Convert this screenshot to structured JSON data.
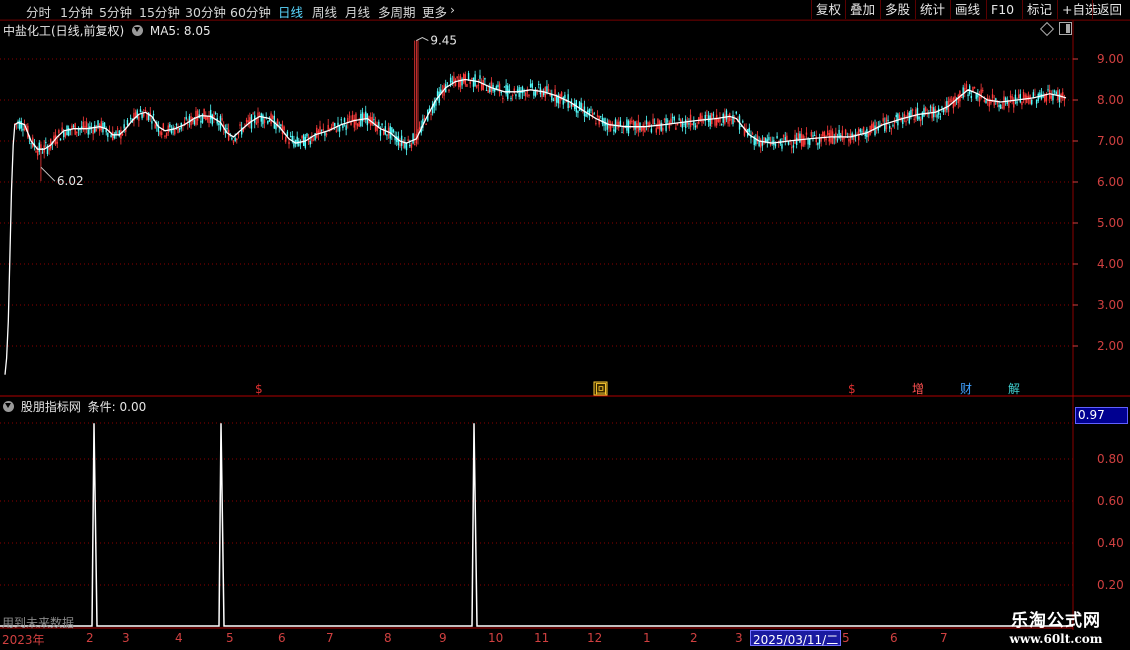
{
  "toolbar": {
    "left_items": [
      "分时",
      "1分钟",
      "5分钟",
      "15分钟",
      "30分钟",
      "60分钟",
      "日线",
      "周线",
      "月线",
      "多周期",
      "更多"
    ],
    "active_item": "日线",
    "more_arrow": "›",
    "right_items": [
      "复权",
      "叠加",
      "多股",
      "统计",
      "画线",
      "F10",
      "标记",
      "+自选",
      "返回"
    ]
  },
  "main_panel": {
    "title": "中盐化工(日线,前复权)",
    "ma_label": "MA5: 8.05",
    "high_label": "9.45",
    "low_label": "6.02",
    "y_ticks": [
      "9.00",
      "8.00",
      "7.00",
      "6.00",
      "5.00",
      "4.00",
      "3.00",
      "2.00"
    ],
    "event_markers": [
      {
        "text": "$",
        "color": "#e03030"
      },
      {
        "text": "回",
        "color": "#ffcc33"
      },
      {
        "text": "$",
        "color": "#e03030"
      },
      {
        "text": "增",
        "color": "#ff5050"
      },
      {
        "text": "财",
        "color": "#40a0ff"
      },
      {
        "text": "解",
        "color": "#40d0d0"
      }
    ]
  },
  "indicator_panel": {
    "title": "股朋指标网",
    "condition_label": "条件: 0.00",
    "current_value": "0.97",
    "y_ticks": [
      "0.80",
      "0.60",
      "0.40",
      "0.20"
    ],
    "future_data_note": "用到未来数据"
  },
  "x_axis": {
    "labels": [
      "2023年",
      "2",
      "3",
      "4",
      "5",
      "6",
      "7",
      "8",
      "9",
      "10",
      "11",
      "12",
      "1",
      "2",
      "3",
      "5",
      "6",
      "7"
    ],
    "cursor_date": "2025/03/11/二"
  },
  "watermark": {
    "title": "乐淘公式网",
    "url": "www.60lt.com"
  },
  "colors": {
    "up": "#ff3c3c",
    "down": "#54ffff",
    "ma": "#ffffff",
    "grid": "#8b0000",
    "axis": "#d04040"
  },
  "chart_data": [
    {
      "type": "candlestick",
      "title": "中盐化工(日线,前复权)",
      "series": [
        {
          "name": "MA5",
          "last": 8.05
        }
      ],
      "ylim": [
        1.2,
        9.9
      ],
      "annotations": [
        {
          "label": "9.45",
          "value": 9.45
        },
        {
          "label": "6.02",
          "value": 6.02
        }
      ],
      "ma5_path": [
        [
          0,
          1.3
        ],
        [
          1,
          1.7
        ],
        [
          2,
          2.6
        ],
        [
          3,
          4.2
        ],
        [
          4,
          5.8
        ],
        [
          5,
          6.9
        ],
        [
          6,
          7.4
        ],
        [
          8,
          7.45
        ],
        [
          12,
          7.4
        ],
        [
          16,
          7.0
        ],
        [
          20,
          6.8
        ],
        [
          24,
          6.8
        ],
        [
          28,
          6.9
        ],
        [
          32,
          7.1
        ],
        [
          36,
          7.25
        ],
        [
          42,
          7.3
        ],
        [
          50,
          7.3
        ],
        [
          58,
          7.35
        ],
        [
          62,
          7.3
        ],
        [
          66,
          7.15
        ],
        [
          70,
          7.15
        ],
        [
          74,
          7.3
        ],
        [
          78,
          7.5
        ],
        [
          82,
          7.65
        ],
        [
          86,
          7.7
        ],
        [
          90,
          7.6
        ],
        [
          94,
          7.35
        ],
        [
          98,
          7.25
        ],
        [
          104,
          7.3
        ],
        [
          110,
          7.4
        ],
        [
          116,
          7.55
        ],
        [
          120,
          7.62
        ],
        [
          126,
          7.6
        ],
        [
          132,
          7.45
        ],
        [
          136,
          7.2
        ],
        [
          140,
          7.1
        ],
        [
          144,
          7.25
        ],
        [
          150,
          7.45
        ],
        [
          156,
          7.6
        ],
        [
          162,
          7.55
        ],
        [
          168,
          7.35
        ],
        [
          174,
          7.05
        ],
        [
          178,
          6.95
        ],
        [
          184,
          7.0
        ],
        [
          190,
          7.15
        ],
        [
          198,
          7.25
        ],
        [
          206,
          7.4
        ],
        [
          214,
          7.5
        ],
        [
          222,
          7.55
        ],
        [
          230,
          7.3
        ],
        [
          236,
          7.2
        ],
        [
          242,
          7.0
        ],
        [
          246,
          6.95
        ],
        [
          252,
          7.05
        ],
        [
          258,
          7.55
        ],
        [
          264,
          8.0
        ],
        [
          270,
          8.3
        ],
        [
          276,
          8.45
        ],
        [
          282,
          8.5
        ],
        [
          290,
          8.45
        ],
        [
          298,
          8.3
        ],
        [
          306,
          8.2
        ],
        [
          314,
          8.2
        ],
        [
          322,
          8.25
        ],
        [
          330,
          8.2
        ],
        [
          338,
          8.1
        ],
        [
          346,
          7.95
        ],
        [
          354,
          7.75
        ],
        [
          362,
          7.55
        ],
        [
          370,
          7.4
        ],
        [
          380,
          7.35
        ],
        [
          392,
          7.35
        ],
        [
          404,
          7.4
        ],
        [
          414,
          7.45
        ],
        [
          424,
          7.5
        ],
        [
          436,
          7.55
        ],
        [
          444,
          7.6
        ],
        [
          448,
          7.55
        ],
        [
          452,
          7.35
        ],
        [
          456,
          7.15
        ],
        [
          462,
          7.0
        ],
        [
          470,
          6.95
        ],
        [
          480,
          7.0
        ],
        [
          492,
          7.05
        ],
        [
          506,
          7.1
        ],
        [
          518,
          7.1
        ],
        [
          528,
          7.2
        ],
        [
          538,
          7.4
        ],
        [
          550,
          7.55
        ],
        [
          560,
          7.65
        ],
        [
          570,
          7.7
        ],
        [
          578,
          7.85
        ],
        [
          584,
          8.05
        ],
        [
          590,
          8.25
        ],
        [
          596,
          8.15
        ],
        [
          602,
          8.0
        ],
        [
          610,
          7.95
        ],
        [
          620,
          8.0
        ],
        [
          630,
          8.05
        ],
        [
          640,
          8.15
        ],
        [
          646,
          8.1
        ],
        [
          650,
          8.05
        ]
      ]
    },
    {
      "type": "line",
      "title": "股朋指标网",
      "ylim": [
        0,
        1
      ],
      "series": [
        {
          "name": "条件",
          "spikes_at": [
            55,
            128,
            275
          ],
          "peak": 0.97
        }
      ]
    }
  ]
}
